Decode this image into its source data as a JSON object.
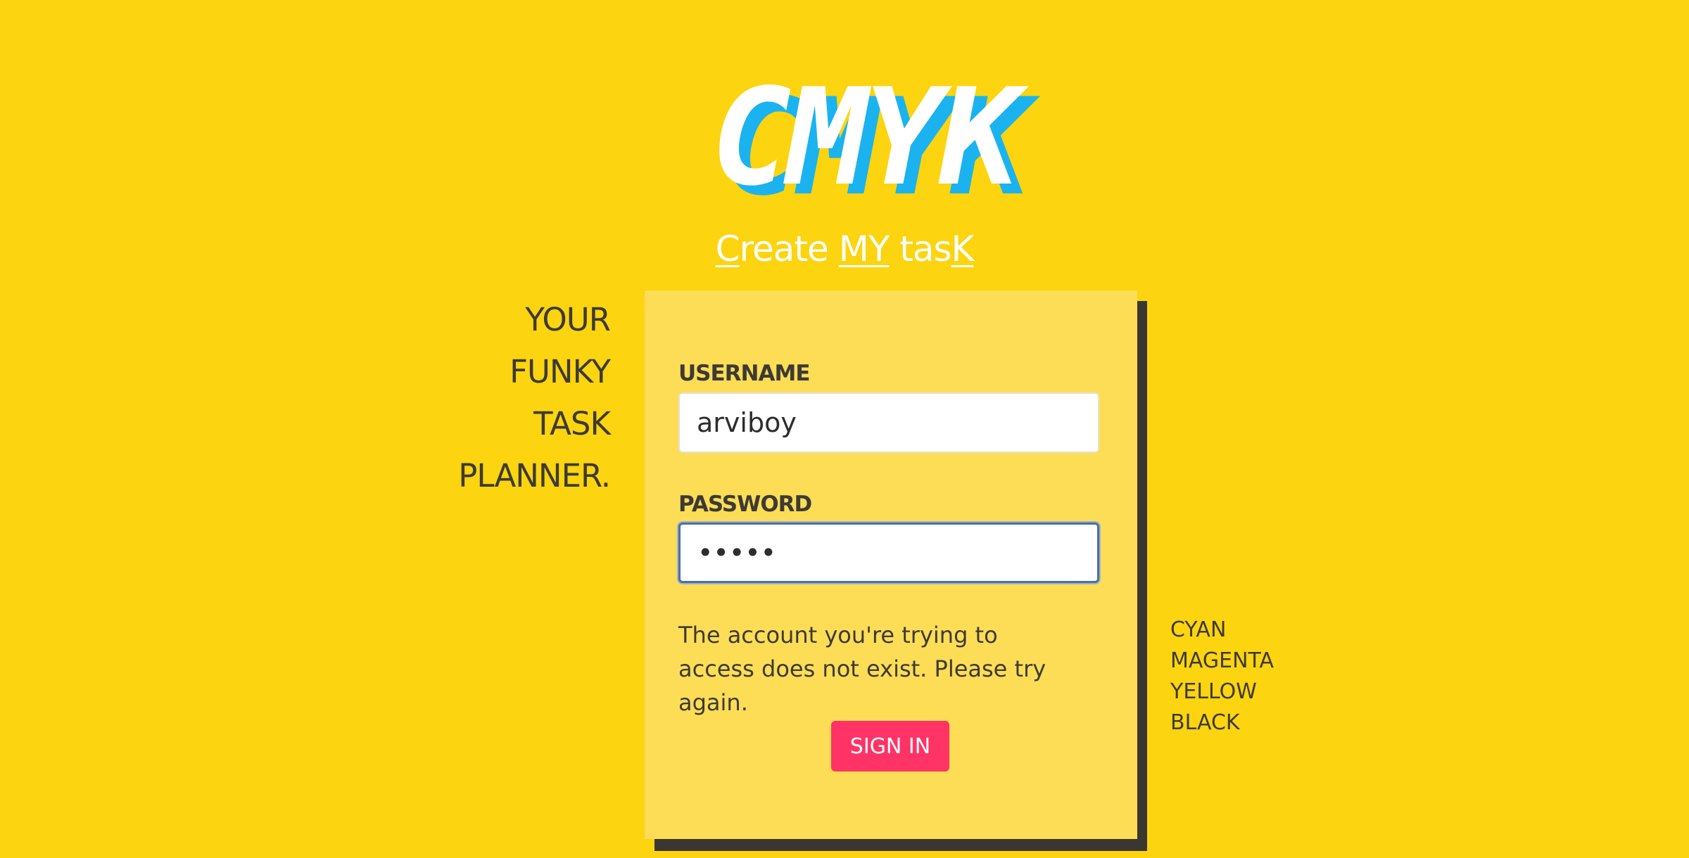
{
  "logo": {
    "text": "CMYK",
    "colors": {
      "face": "#ffffff",
      "shadow": "#1ab3ef"
    }
  },
  "tagline": {
    "part1_ul": "C",
    "part1_rest": "reate ",
    "part2_ul": "MY",
    "part3_rest": " tas",
    "part3_ul": "K"
  },
  "slogan": [
    "YOUR",
    "FUNKY",
    "TASK",
    "PLANNER."
  ],
  "form": {
    "username_label": "USERNAME",
    "username_value": "arviboy",
    "password_label": "PASSWORD",
    "password_value": "•••••",
    "error_message": "The account you're trying to access does not exist. Please try again.",
    "sign_in_label": "SIGN IN"
  },
  "colors_list": [
    "CYAN",
    "MAGENTA",
    "YELLOW",
    "BLACK"
  ],
  "theme": {
    "background": "#fcd40f",
    "card": "#fddd55",
    "card_shadow": "#3a3631",
    "button": "#ff3366",
    "text": "#3d3a35"
  }
}
